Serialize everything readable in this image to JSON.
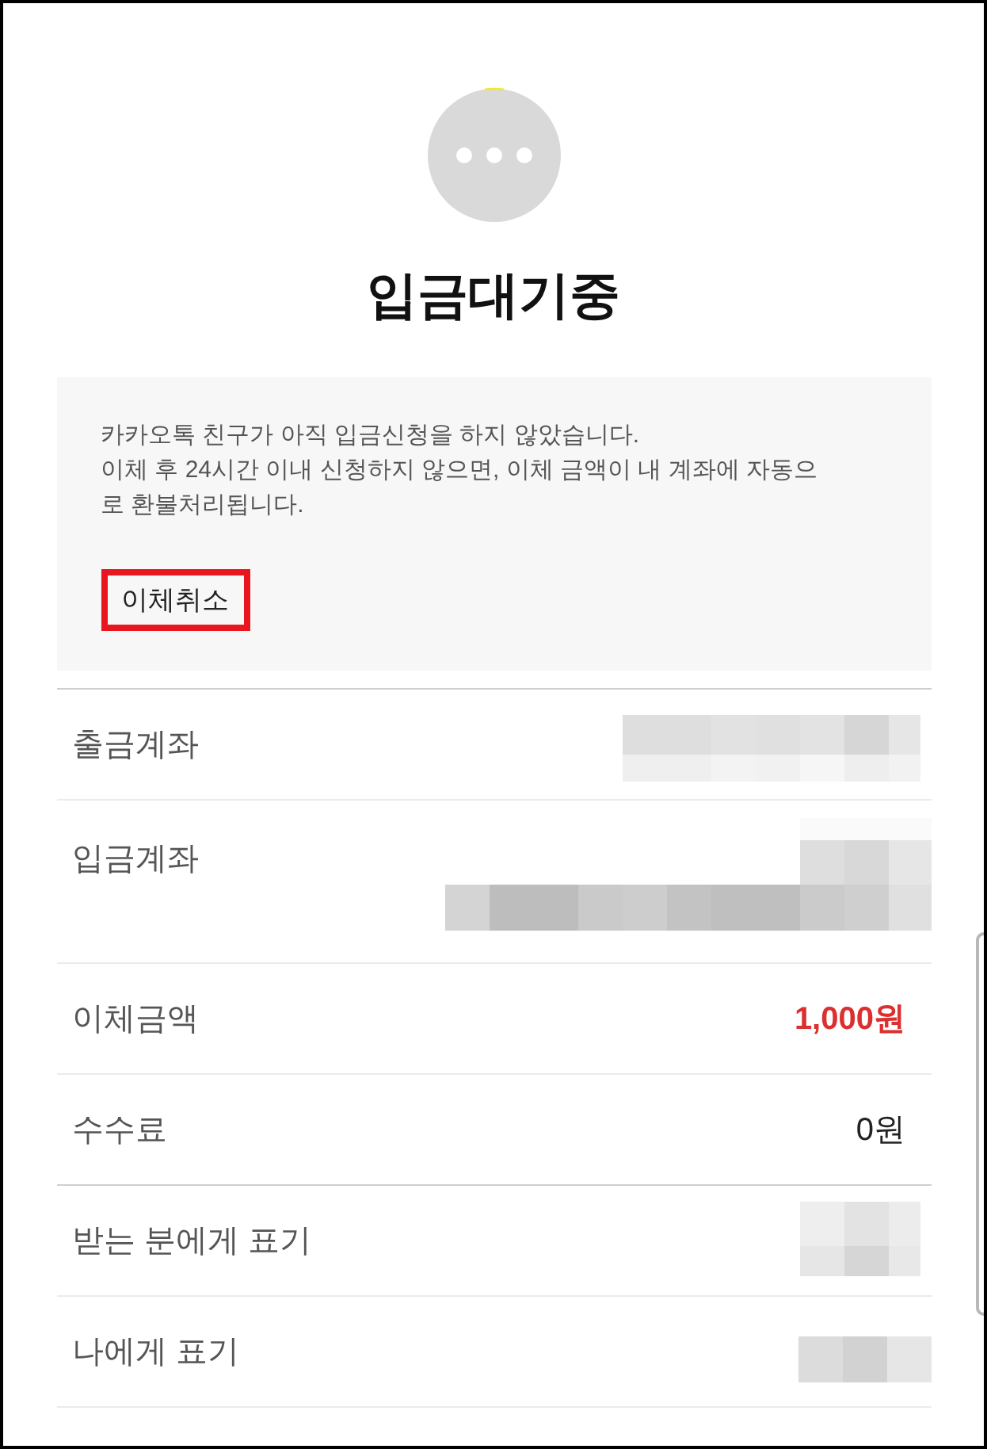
{
  "status_title": "입금대기중",
  "notice": {
    "lines": [
      "카카오톡 친구가 아직 입금신청을 하지 않았습니다.",
      "이체 후 24시간 이내 신청하지 않으면, 이체 금액이 내 계좌에 자동으로 환불처리됩니다."
    ],
    "cancel_button": "이체취소"
  },
  "sections": [
    {
      "rows": [
        {
          "label": "출금계좌",
          "kind": "wide_mask"
        },
        {
          "label": "입금계좌",
          "kind": "tall_mask"
        },
        {
          "label": "이체금액",
          "kind": "text",
          "value": "1,000원",
          "emphasized": true
        },
        {
          "label": "수수료",
          "kind": "text",
          "value": "0원",
          "emphasized": false
        }
      ]
    },
    {
      "rows": [
        {
          "label": "받는 분에게 표기",
          "kind": "small_mask"
        },
        {
          "label": "나에게 표기",
          "kind": "strip_mask"
        }
      ]
    }
  ]
}
